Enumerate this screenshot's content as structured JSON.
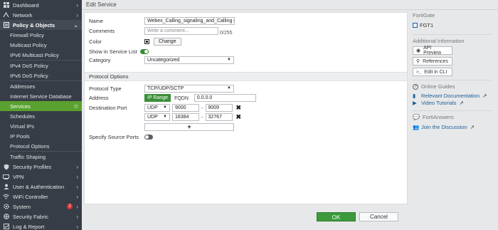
{
  "sidebar": {
    "top_items": [
      {
        "label": "Dashboard",
        "icon": "dashboard-icon"
      },
      {
        "label": "Network",
        "icon": "network-icon"
      }
    ],
    "expanded": {
      "label": "Policy & Objects",
      "icon": "policy-icon"
    },
    "sub_items": [
      {
        "label": "Firewall Policy"
      },
      {
        "label": "Multicast Policy"
      },
      {
        "label": "IPv6 Multicast Policy"
      },
      {
        "label": "IPv4 DoS Policy"
      },
      {
        "label": "IPv6 DoS Policy"
      },
      {
        "label": "Addresses"
      },
      {
        "label": "Internet Service Database"
      },
      {
        "label": "Services",
        "active": true
      },
      {
        "label": "Schedules"
      },
      {
        "label": "Virtual IPs"
      },
      {
        "label": "IP Pools"
      },
      {
        "label": "Protocol Options"
      },
      {
        "label": "Traffic Shaping"
      }
    ],
    "bottom_items": [
      {
        "label": "Security Profiles",
        "icon": "shield-icon"
      },
      {
        "label": "VPN",
        "icon": "vpn-icon"
      },
      {
        "label": "User & Authentication",
        "icon": "user-icon"
      },
      {
        "label": "WiFi Controller",
        "icon": "wifi-icon"
      },
      {
        "label": "System",
        "icon": "gear-icon",
        "badge": "2"
      },
      {
        "label": "Security Fabric",
        "icon": "fabric-icon"
      },
      {
        "label": "Log & Report",
        "icon": "log-icon"
      }
    ]
  },
  "header": {
    "title": "Edit Service"
  },
  "form": {
    "name_label": "Name",
    "name_value": "Webex_Calling_signaling_and_Calling m",
    "comments_label": "Comments",
    "comments_placeholder": "Write a comment...",
    "comments_counter": "0/255",
    "color_label": "Color",
    "color_change": "Change",
    "show_label": "Show in Service List",
    "category_label": "Category",
    "category_value": "Uncategorized",
    "section_title": "Protocol Options",
    "protocol_type_label": "Protocol Type",
    "protocol_type_value": "TCP/UDP/SCTP",
    "address_label": "Address",
    "address_mode_on": "IP Range",
    "address_mode_off": "FQDN",
    "address_value": "0.0.0.0",
    "dest_port_label": "Destination Port",
    "ports": [
      {
        "proto": "UDP",
        "low": "9000",
        "sep": "-",
        "high": "9009"
      },
      {
        "proto": "UDP",
        "low": "16384",
        "sep": "-",
        "high": "32767"
      }
    ],
    "add_symbol": "+",
    "specify_source_label": "Specify Source Ports"
  },
  "footer": {
    "ok": "OK",
    "cancel": "Cancel"
  },
  "right_panel": {
    "device_title": "FortiGate",
    "device_name": "FGT1",
    "additional_title": "Additional Information",
    "api_preview": "API Preview",
    "references": "References",
    "edit_cli": "Edit in CLI",
    "guides_title": "Online Guides",
    "relevant_docs": "Relevant Documentation",
    "video_tutorials": "Video Tutorials",
    "answers_title": "FortiAnswers",
    "join_discussion": "Join the Discussion"
  },
  "colors": {
    "accent": "#3a8f3a",
    "sidebar": "#373d47",
    "active": "#5aa12f",
    "link": "#1d5f9a"
  }
}
